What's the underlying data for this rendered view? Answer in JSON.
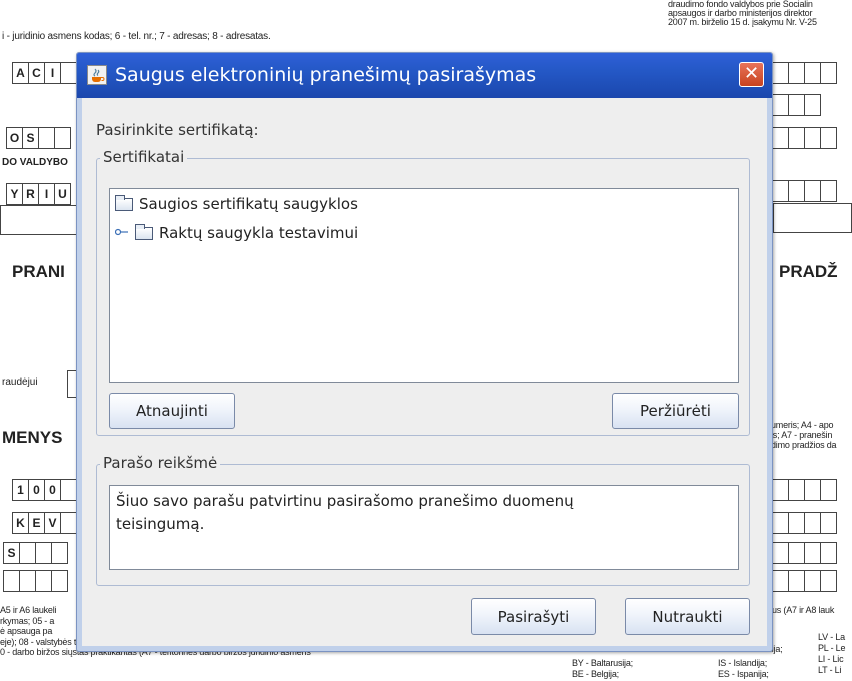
{
  "background": {
    "top_right_line1": "draudimo fondo valdybos prie Socialin",
    "top_right_line2": "apsaugos ir darbo ministerijos direktor",
    "top_right_line3": "2007 m. birželio 15 d. įsakymu Nr. V-25",
    "top_left_note": "i - juridinio asmens kodas; 6 - tel. nr.; 7 - adresas; 8 - adresatas.",
    "row1_cells": [
      "A",
      "C",
      "I"
    ],
    "row2_cells": [
      "O",
      "S"
    ],
    "row2_label": "DO VALDYBO",
    "row3_cells": [
      "Y",
      "R",
      "I",
      "U"
    ],
    "heading_left": "PRANI",
    "heading_right": "PRADŽ",
    "insured_label": "raudėjui",
    "data_label": "MENYS",
    "right_note_line1": "umeris; A4 - apo",
    "right_note_line2": "is; A7 - pranešin",
    "right_note_line3": "dimo pradžios da",
    "row4_cells": [
      "1",
      "0",
      "0"
    ],
    "row5_cells": [
      "K",
      "E",
      "V"
    ],
    "row6_cells": [
      "S"
    ],
    "bottom_left_1": "A5 ir A6 laukeli",
    "bottom_left_2": "rkymas; 05 - a",
    "bottom_left_3": "ė apsauga pa",
    "bottom_left_4": "eje); 08 - valstybės tarnautojo perkėlimas (Lietuvoje);",
    "bottom_left_5": "0 - darbo biržos siųstas praktikantas (A7 - teritorinės darbo biržos juridinio asmens",
    "bottom_right_1": "us (A7 ir A8 lauk",
    "bottom_right_2": "LV - La",
    "bottom_right_3": "PL - Le",
    "bottom_right_4": "LI - Lic",
    "bottom_right_5": "LT - Li",
    "bottom_mid_1": "BY - Baltarusija;",
    "bottom_mid_2": "BE - Belgija;",
    "bottom_mid_3": "IS - Islandija;",
    "bottom_mid_4": "ES - Ispanija;",
    "bottom_mid_5": "lija;"
  },
  "dialog": {
    "title": "Saugus elektroninių pranešimų pasirašymas",
    "close_symbol": "✕",
    "prompt": "Pasirinkite sertifikatą:",
    "cert_group_title": "Sertifikatai",
    "tree": [
      {
        "label": "Saugios sertifikatų saugyklos",
        "level": 0
      },
      {
        "label": "Raktų saugykla testavimui",
        "level": 1
      }
    ],
    "refresh_button": "Atnaujinti",
    "view_button": "Peržiūrėti",
    "signature_group_title": "Parašo reikšmė",
    "signature_text_line1": "Šiuo savo parašu patvirtinu pasirašomo pranešimo duomenų",
    "signature_text_line2": "teisingumą.",
    "sign_button": "Pasirašyti",
    "cancel_button": "Nutraukti"
  },
  "colors": {
    "titlebar": "#2458c6",
    "close_button": "#d0502e",
    "dialog_border": "#c0d0ea",
    "content_bg": "#eeeeee"
  }
}
